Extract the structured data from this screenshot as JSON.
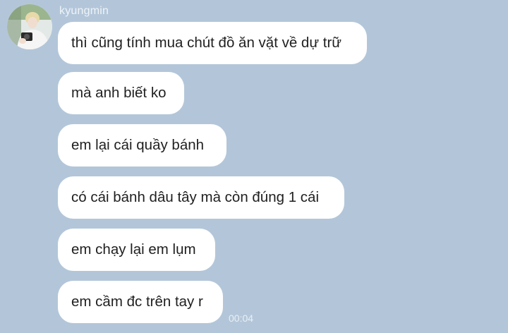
{
  "conversation": {
    "sender_name": "kyungmin",
    "messages": [
      {
        "text": "thì cũng tính mua chút đồ ăn vặt về dự trữ"
      },
      {
        "text": "mà anh biết ko"
      },
      {
        "text": "em lại cái quầy bánh"
      },
      {
        "text": "có cái bánh dâu tây mà còn đúng 1 cái"
      },
      {
        "text": "em chạy lại em lụm"
      },
      {
        "text": "em cầm đc trên tay r"
      }
    ],
    "last_timestamp": "00:04"
  },
  "colors": {
    "background": "#b3c6d9",
    "bubble": "#ffffff",
    "text": "#1f1f1f",
    "meta_text": "#eef3f8"
  }
}
